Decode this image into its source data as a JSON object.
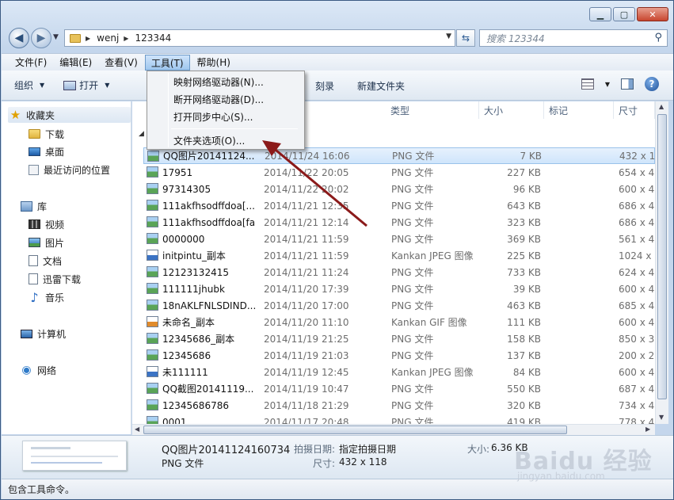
{
  "address": {
    "crumbs": [
      "wenj",
      "123344"
    ],
    "search_placeholder": "搜索 123344"
  },
  "menubar": [
    "文件(F)",
    "编辑(E)",
    "查看(V)",
    "工具(T)",
    "帮助(H)"
  ],
  "toolbar": {
    "organize": "组织",
    "open": "打开",
    "burn": "刻录",
    "new_folder": "新建文件夹"
  },
  "tools_menu": [
    "映射网络驱动器(N)...",
    "断开网络驱动器(D)...",
    "打开同步中心(S)...",
    "文件夹选项(O)..."
  ],
  "nav": {
    "favorites": "收藏夹",
    "fav_items": [
      "下载",
      "桌面",
      "最近访问的位置"
    ],
    "libraries": "库",
    "lib_items": [
      "视频",
      "图片",
      "文档",
      "迅雷下载",
      "音乐"
    ],
    "computer": "计算机",
    "network": "网络"
  },
  "columns": {
    "type": "类型",
    "size": "大小",
    "tags": "标记",
    "dim": "尺寸"
  },
  "files": [
    {
      "name": "QQ图片20141124...",
      "date": "2014/11/24 16:06",
      "type": "PNG 文件",
      "size": "7 KB",
      "dim": "432 x 1:",
      "icon": "png"
    },
    {
      "name": "17951",
      "date": "2014/11/22 20:05",
      "type": "PNG 文件",
      "size": "227 KB",
      "dim": "654 x 4",
      "icon": "png"
    },
    {
      "name": "97314305",
      "date": "2014/11/22 20:02",
      "type": "PNG 文件",
      "size": "96 KB",
      "dim": "600 x 4",
      "icon": "png"
    },
    {
      "name": "111akfhsodffdoa[...",
      "date": "2014/11/21 12:35",
      "type": "PNG 文件",
      "size": "643 KB",
      "dim": "686 x 4",
      "icon": "png"
    },
    {
      "name": "111akfhsodffdoa[fa",
      "date": "2014/11/21 12:14",
      "type": "PNG 文件",
      "size": "323 KB",
      "dim": "686 x 4",
      "icon": "png"
    },
    {
      "name": "0000000",
      "date": "2014/11/21 11:59",
      "type": "PNG 文件",
      "size": "369 KB",
      "dim": "561 x 4",
      "icon": "png"
    },
    {
      "name": "initpintu_副本",
      "date": "2014/11/21 11:59",
      "type": "Kankan JPEG 图像",
      "size": "225 KB",
      "dim": "1024 x",
      "icon": "jpg"
    },
    {
      "name": "12123132415",
      "date": "2014/11/21 11:24",
      "type": "PNG 文件",
      "size": "733 KB",
      "dim": "624 x 4",
      "icon": "png"
    },
    {
      "name": "111111jhubk",
      "date": "2014/11/20 17:39",
      "type": "PNG 文件",
      "size": "39 KB",
      "dim": "600 x 4",
      "icon": "png"
    },
    {
      "name": "18nAKLFNLSDIND...",
      "date": "2014/11/20 17:00",
      "type": "PNG 文件",
      "size": "463 KB",
      "dim": "685 x 4",
      "icon": "png"
    },
    {
      "name": "未命名_副本",
      "date": "2014/11/20 11:10",
      "type": "Kankan GIF 图像",
      "size": "111 KB",
      "dim": "600 x 4",
      "icon": "gif"
    },
    {
      "name": "12345686_副本",
      "date": "2014/11/19 21:25",
      "type": "PNG 文件",
      "size": "158 KB",
      "dim": "850 x 3",
      "icon": "png"
    },
    {
      "name": "12345686",
      "date": "2014/11/19 21:03",
      "type": "PNG 文件",
      "size": "137 KB",
      "dim": "200 x 2",
      "icon": "png"
    },
    {
      "name": "未111111",
      "date": "2014/11/19 12:45",
      "type": "Kankan JPEG 图像",
      "size": "84 KB",
      "dim": "600 x 4",
      "icon": "jpg"
    },
    {
      "name": "QQ截图20141119...",
      "date": "2014/11/19 10:47",
      "type": "PNG 文件",
      "size": "550 KB",
      "dim": "687 x 4",
      "icon": "png"
    },
    {
      "name": "12345686786",
      "date": "2014/11/18 21:29",
      "type": "PNG 文件",
      "size": "320 KB",
      "dim": "734 x 4",
      "icon": "png"
    },
    {
      "name": "0001",
      "date": "2014/11/17 20:48",
      "type": "PNG 文件",
      "size": "419 KB",
      "dim": "778 x 4",
      "icon": "png"
    }
  ],
  "details": {
    "filename": "QQ图片20141124160734",
    "filetype": "PNG 文件",
    "shot_label": "拍摄日期:",
    "shot_value": "指定拍摄日期",
    "size_label": "大小:",
    "size_value": "6.36 KB",
    "dim_label": "尺寸:",
    "dim_value": "432 x 118"
  },
  "status": "包含工具命令。",
  "watermark": "Baidu 经验",
  "watermark_url": "jingyan.baidu.com"
}
